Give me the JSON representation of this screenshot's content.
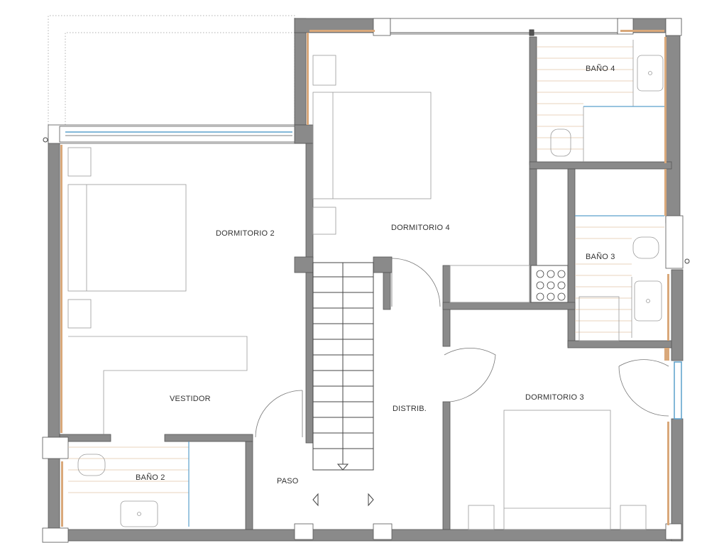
{
  "rooms": {
    "dormitorio_2": "DORMITORIO 2",
    "dormitorio_4": "DORMITORIO 4",
    "dormitorio_3": "DORMITORIO 3",
    "bano_4": "BAÑO 4",
    "bano_3": "BAÑO 3",
    "bano_2": "BAÑO 2",
    "vestidor": "VESTIDOR",
    "distrib": "DISTRIB.",
    "paso": "PASO"
  },
  "colors": {
    "wall_fill": "#8a8a8a",
    "wall_stroke": "#555555",
    "line": "#444444",
    "wood": "#d9a87a",
    "glass": "#5aa0cc",
    "thin": "#9a9a9a"
  }
}
